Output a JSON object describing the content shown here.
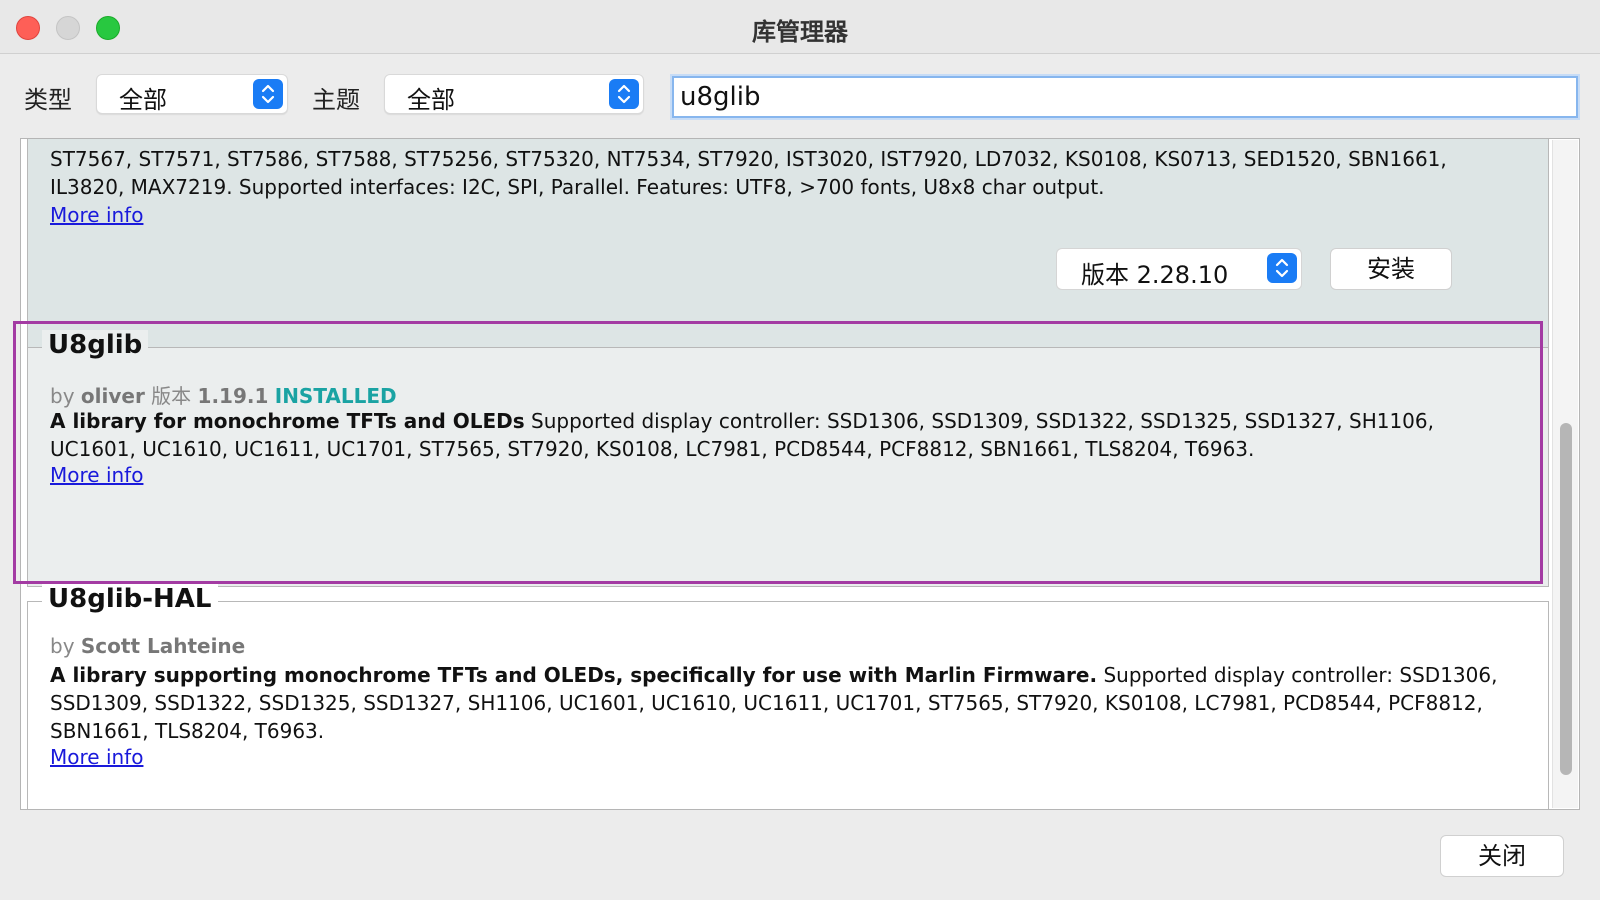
{
  "window": {
    "title": "库管理器"
  },
  "filters": {
    "type_label": "类型",
    "type_value": "全部",
    "topic_label": "主题",
    "topic_value": "全部",
    "search_value": "u8glib"
  },
  "entries": [
    {
      "body_line0": "ST7567, ST7571, ST7586, ST7588, ST75256, ST75320, NT7534, ST7920, IST3020, IST7920, LD7032, KS0108, KS0713, SED1520, SBN1661,",
      "body_line1": "IL3820, MAX7219. Supported interfaces: I2C, SPI, Parallel. Features: UTF8, >700 fonts, U8x8 char output.",
      "more_info": "More info",
      "version_label": "版本 2.28.10",
      "install_label": "安装"
    },
    {
      "name": "U8glib",
      "by": "by",
      "author": "oliver",
      "version_prefix": "版本",
      "version": "1.19.1",
      "installed": "INSTALLED",
      "summary": "A library for monochrome TFTs and OLEDs",
      "description_line0": " Supported display controller: SSD1306, SSD1309, SSD1322, SSD1325, SSD1327, SH1106,",
      "description_line1": "UC1601, UC1610, UC1611, UC1701, ST7565, ST7920, KS0108, LC7981, PCD8544, PCF8812, SBN1661, TLS8204, T6963.",
      "more_info": "More info"
    },
    {
      "name": "U8glib-HAL",
      "by": "by",
      "author": "Scott Lahteine",
      "summary": "A library supporting monochrome TFTs and OLEDs, specifically for use with Marlin Firmware.",
      "description_line0": " Supported display controller: SSD1306,",
      "description_line1": "SSD1309, SSD1322, SSD1325, SSD1327, SH1106, UC1601, UC1610, UC1611, UC1701, ST7565, ST7920, KS0108, LC7981, PCD8544, PCF8812,",
      "description_line2": "SBN1661, TLS8204, T6963.",
      "more_info": "More info"
    }
  ],
  "footer": {
    "close_label": "关闭"
  },
  "colors": {
    "highlight": "#a33ba3",
    "installed": "#1aa3a3",
    "link": "#1a1adb",
    "accent": "#1a7cf5"
  },
  "icons": [
    "close-traffic-light-icon",
    "minimize-traffic-light-icon",
    "maximize-traffic-light-icon",
    "up-down-chevron-icon"
  ]
}
